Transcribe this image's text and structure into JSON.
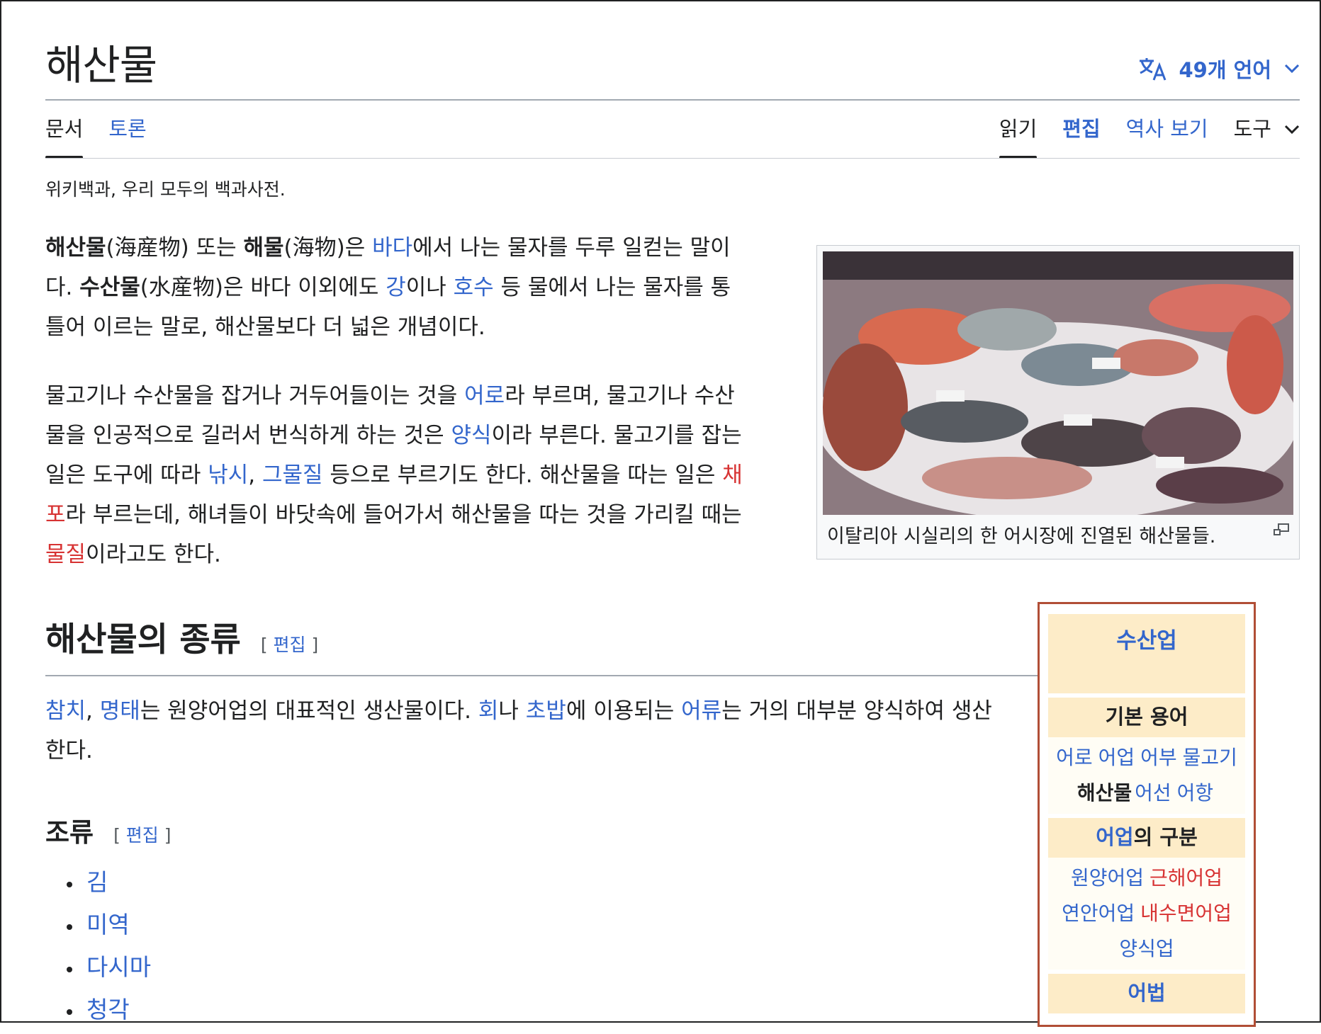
{
  "page": {
    "title": "해산물",
    "languages": "49개 언어",
    "tagline": "위키백과, 우리 모두의 백과사전."
  },
  "tabs": {
    "left": [
      "문서",
      "토론"
    ],
    "right": [
      "읽기",
      "편집",
      "역사 보기",
      "도구"
    ]
  },
  "intro": {
    "p1": [
      {
        "t": "해산물",
        "s": "b"
      },
      {
        "t": "(海産物) 또는 "
      },
      {
        "t": "해물",
        "s": "b"
      },
      {
        "t": "(海物)은 "
      },
      {
        "t": "바다",
        "s": "link"
      },
      {
        "t": "에서 나는 물자를 두루 일컫는 말이"
      },
      {
        "br": true
      },
      {
        "t": "다. "
      },
      {
        "t": "수산물",
        "s": "b"
      },
      {
        "t": "(水産物)은 바다 이외에도 "
      },
      {
        "t": "강",
        "s": "link"
      },
      {
        "t": "이나 "
      },
      {
        "t": "호수",
        "s": "link"
      },
      {
        "t": " 등 물에서 나는 물자를 통"
      },
      {
        "br": true
      },
      {
        "t": "틀어 이르는 말로, 해산물보다 더 넓은 개념이다."
      }
    ],
    "p2": [
      {
        "t": "물고기나 수산물을 잡거나 거두어들이는 것을 "
      },
      {
        "t": "어로",
        "s": "link"
      },
      {
        "t": "라 부르며, 물고기나 수산"
      },
      {
        "br": true
      },
      {
        "t": "물을 인공적으로 길러서 번식하게 하는 것은 "
      },
      {
        "t": "양식",
        "s": "link"
      },
      {
        "t": "이라 부른다. 물고기를 잡는"
      },
      {
        "br": true
      },
      {
        "t": "일은 도구에 따라 "
      },
      {
        "t": "낚시",
        "s": "link"
      },
      {
        "t": ", "
      },
      {
        "t": "그물질",
        "s": "link"
      },
      {
        "t": " 등으로 부르기도 한다. 해산물을 따는 일은 "
      },
      {
        "t": "채",
        "s": "red"
      },
      {
        "br": true
      },
      {
        "t": "포",
        "s": "red"
      },
      {
        "t": "라 부르는데, 해녀들이 바닷속에 들어가서 해산물을 따는 것을 가리킬 때는"
      },
      {
        "br": true
      },
      {
        "t": "물질",
        "s": "red"
      },
      {
        "t": "이라고도 한다."
      }
    ]
  },
  "figure": {
    "caption": "이탈리아 시실리의 한 어시장에 진열된 해산물들.",
    "image_alt": "fish-market-photo"
  },
  "section": {
    "heading": "해산물의 종류",
    "edit_open": "[ ",
    "edit_label": "편집",
    "edit_close": " ]",
    "p": [
      {
        "t": "참치",
        "s": "link"
      },
      {
        "t": ", "
      },
      {
        "t": "명태",
        "s": "link"
      },
      {
        "t": "는 원양어업의 대표적인 생산물이다. "
      },
      {
        "t": "회",
        "s": "link"
      },
      {
        "t": "나 "
      },
      {
        "t": "초밥",
        "s": "link"
      },
      {
        "t": "에 이용되는 "
      },
      {
        "t": "어류",
        "s": "link"
      },
      {
        "t": "는 거의 대부분 양식하여 생산"
      },
      {
        "br": true
      },
      {
        "t": "한다."
      }
    ]
  },
  "subsection": {
    "heading": "조류",
    "edit_label": "편집",
    "items": [
      "김",
      "미역",
      "다시마",
      "청각"
    ]
  },
  "navbox": {
    "title": "수산업",
    "group1": "기본 용어",
    "list1": [
      {
        "t": "어로",
        "s": "link"
      },
      {
        "t": "어업",
        "s": "link"
      },
      {
        "t": "어부",
        "s": "link"
      },
      {
        "t": "물고기",
        "s": "link"
      },
      {
        "br": true
      },
      {
        "t": "해산물",
        "s": "b"
      },
      {
        "t": "어선",
        "s": "link"
      },
      {
        "t": "어항",
        "s": "link"
      }
    ],
    "group2_link": "어업",
    "group2_rest": "의 구분",
    "list2": [
      {
        "t": "원양어업",
        "s": "link"
      },
      {
        "t": "근해어업",
        "s": "red"
      },
      {
        "br": true
      },
      {
        "t": "연안어업",
        "s": "link"
      },
      {
        "t": "내수면어업",
        "s": "red"
      },
      {
        "br": true
      },
      {
        "t": "양식업",
        "s": "link"
      }
    ],
    "group3": "어법"
  },
  "colors": {
    "link": "#3366cc",
    "redlink": "#d73333",
    "navbox_border": "#b14e36",
    "navbox_header": "#fdecc8"
  }
}
